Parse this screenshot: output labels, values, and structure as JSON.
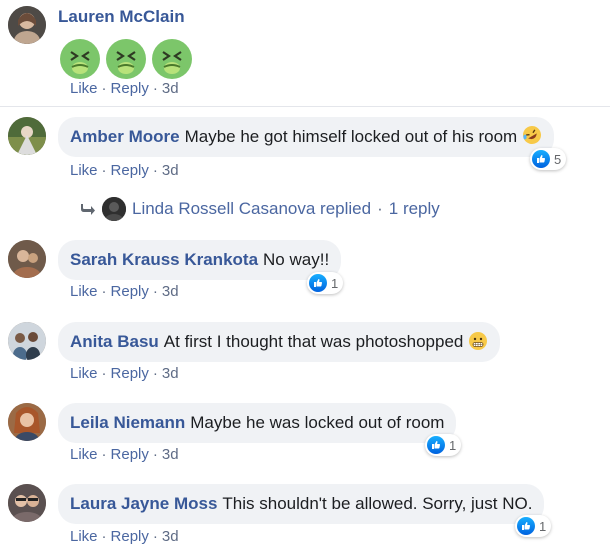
{
  "comments": [
    {
      "author": "Lauren McClain",
      "text": "",
      "stickers": [
        "nauseated-face-emoji",
        "nauseated-face-emoji",
        "nauseated-face-emoji"
      ],
      "like": "Like",
      "reply": "Reply",
      "time": "3d"
    },
    {
      "author": "Amber Moore",
      "text": "Maybe he got himself locked out of his room",
      "trailing_emoji": "rofl-emoji",
      "like": "Like",
      "reply": "Reply",
      "time": "3d",
      "reaction_count": "5"
    },
    {
      "author": "Sarah Krauss Krankota",
      "text": "No way!!",
      "like": "Like",
      "reply": "Reply",
      "time": "3d",
      "reaction_count": "1"
    },
    {
      "author": "Anita Basu",
      "text": "At first I thought that was photoshopped",
      "trailing_emoji": "grimacing-emoji",
      "like": "Like",
      "reply": "Reply",
      "time": "3d"
    },
    {
      "author": "Leila Niemann",
      "text": "Maybe he was locked out of room",
      "like": "Like",
      "reply": "Reply",
      "time": "3d",
      "reaction_count": "1"
    },
    {
      "author": "Laura Jayne Moss",
      "text": "This shouldn't be allowed. Sorry, just NO.",
      "like": "Like",
      "reply": "Reply",
      "time": "3d",
      "reaction_count": "1"
    }
  ],
  "replies_link": {
    "text": "Linda Rossell Casanova replied",
    "count": "1 reply"
  },
  "separator": "·",
  "colors": {
    "author": "#385898",
    "link": "#4b67a1",
    "bubble": "#f0f2f5",
    "like_blue": "#1877f2"
  }
}
